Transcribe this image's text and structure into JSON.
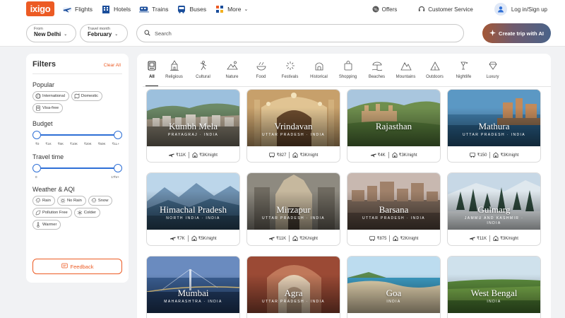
{
  "brand": {
    "logo": "ixigo",
    "accent": "#ec5b24"
  },
  "nav": {
    "items": [
      {
        "label": "Flights",
        "icon": "flights-icon"
      },
      {
        "label": "Hotels",
        "icon": "hotels-icon"
      },
      {
        "label": "Trains",
        "icon": "trains-icon"
      },
      {
        "label": "Buses",
        "icon": "buses-icon"
      },
      {
        "label": "More",
        "icon": "more-icon"
      }
    ],
    "offers": "Offers",
    "customer_service": "Customer Service",
    "login": "Log in/Sign up"
  },
  "search": {
    "from_label": "From",
    "from_value": "New Delhi",
    "month_label": "Travel month",
    "month_value": "February",
    "placeholder": "Search",
    "ai_button": "Create trip with AI"
  },
  "filters": {
    "title": "Filters",
    "clear_all": "Clear All",
    "popular": {
      "title": "Popular",
      "chips": [
        "International",
        "Domestic",
        "Visa-free"
      ]
    },
    "budget": {
      "title": "Budget",
      "ticks": [
        "₹0",
        "₹1K",
        "₹5K",
        "₹10K",
        "₹20K",
        "₹50K",
        "₹1L+"
      ],
      "low": 0,
      "high": 1
    },
    "travel_time": {
      "title": "Travel time",
      "ticks": [
        "0",
        "17hr+"
      ],
      "low": 0,
      "high": 1
    },
    "weather": {
      "title": "Weather & AQI",
      "chips": [
        "Rain",
        "No Rain",
        "Snow",
        "Pollution Free",
        "Colder",
        "Warmer"
      ]
    },
    "feedback": "Feedback"
  },
  "categories": [
    {
      "label": "All",
      "icon": "all-icon",
      "active": true
    },
    {
      "label": "Religious",
      "icon": "temple-icon"
    },
    {
      "label": "Cultural",
      "icon": "dancer-icon"
    },
    {
      "label": "Nature",
      "icon": "nature-icon"
    },
    {
      "label": "Food",
      "icon": "food-icon"
    },
    {
      "label": "Festivals",
      "icon": "festival-icon"
    },
    {
      "label": "Historical",
      "icon": "monument-icon"
    },
    {
      "label": "Shopping",
      "icon": "shopping-icon"
    },
    {
      "label": "Beaches",
      "icon": "beach-icon"
    },
    {
      "label": "Mountains",
      "icon": "mountain-icon"
    },
    {
      "label": "Outdoors",
      "icon": "tent-icon"
    },
    {
      "label": "Nightlife",
      "icon": "nightlife-icon"
    },
    {
      "label": "Luxury",
      "icon": "luxury-icon"
    }
  ],
  "destinations": [
    {
      "name": "Kumbh Mela",
      "region": "PRAYAGRAJ · INDIA",
      "transport": "flight",
      "fare": "₹11K",
      "stay": "₹3K/night",
      "scene": "city-hills"
    },
    {
      "name": "Vrindavan",
      "region": "UTTAR PRADESH · INDIA",
      "transport": "bus",
      "fare": "₹827",
      "stay": "₹3K/night",
      "scene": "temple-gold"
    },
    {
      "name": "Rajasthan",
      "region": "",
      "transport": "flight",
      "fare": "₹4K",
      "stay": "₹3K/night",
      "scene": "fort-green"
    },
    {
      "name": "Mathura",
      "region": "UTTAR PRADESH · INDIA",
      "transport": "bus",
      "fare": "₹150",
      "stay": "₹3K/night",
      "scene": "ghat-blue"
    },
    {
      "name": "Himachal Pradesh",
      "region": "NORTH INDIA · INDIA",
      "transport": "flight",
      "fare": "₹7K",
      "stay": "₹5K/night",
      "scene": "mountains-blue"
    },
    {
      "name": "Mirzapur",
      "region": "UTTAR PRADESH · INDIA",
      "transport": "flight",
      "fare": "₹11K",
      "stay": "₹2K/night",
      "scene": "temple-stone"
    },
    {
      "name": "Barsana",
      "region": "UTTAR PRADESH · INDIA",
      "transport": "bus",
      "fare": "₹875",
      "stay": "₹2K/night",
      "scene": "town-dusk"
    },
    {
      "name": "Gulmarg",
      "region": "JAMMU AND KASHMIR · INDIA",
      "transport": "flight",
      "fare": "₹11K",
      "stay": "₹3K/night",
      "scene": "snow-pines"
    },
    {
      "name": "Mumbai",
      "region": "MAHARASHTRA · INDIA",
      "transport": "",
      "fare": "",
      "stay": "",
      "scene": "bridge-night"
    },
    {
      "name": "Agra",
      "region": "UTTAR PRADESH · INDIA",
      "transport": "",
      "fare": "",
      "stay": "",
      "scene": "arch-red"
    },
    {
      "name": "Goa",
      "region": "INDIA",
      "transport": "",
      "fare": "",
      "stay": "",
      "scene": "beach"
    },
    {
      "name": "West Bengal",
      "region": "INDIA",
      "transport": "",
      "fare": "",
      "stay": "",
      "scene": "fields"
    }
  ]
}
